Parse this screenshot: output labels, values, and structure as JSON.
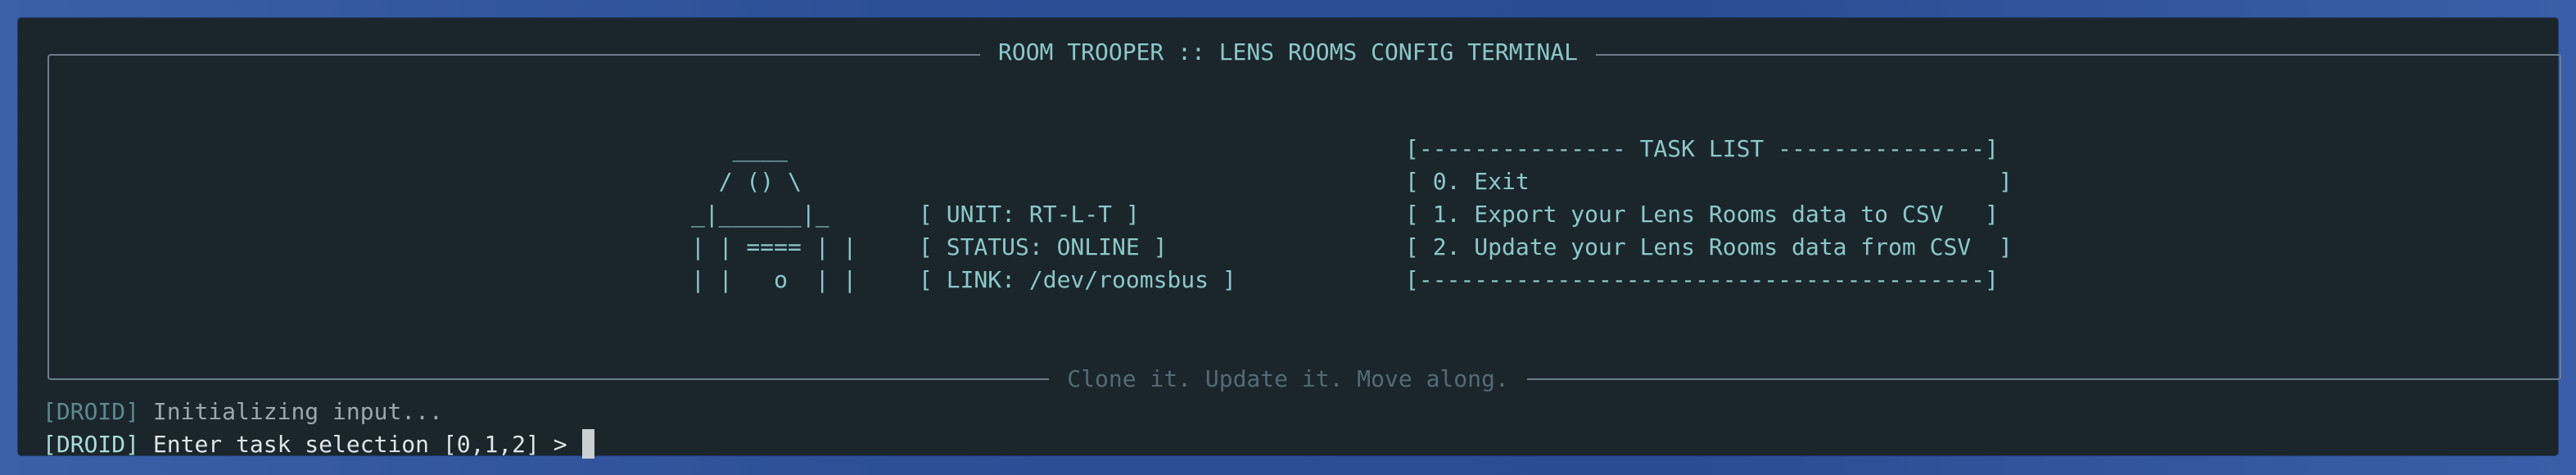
{
  "frame": {
    "title": "ROOM TROOPER :: LENS ROOMS CONFIG TERMINAL",
    "footer": "Clone it. Update it. Move along."
  },
  "droid_art": [
    "   ____",
    "  / () \\",
    "_|______|_",
    "| | ==== | |",
    "| |   o  | |"
  ],
  "unit_info": {
    "unit": "[ UNIT: RT-L-T ]",
    "status": "[ STATUS: ONLINE ]",
    "link": "[ LINK: /dev/roomsbus ]"
  },
  "task_list": {
    "header": "[--------------- TASK LIST ---------------]",
    "items": [
      "[ 0. Exit                                  ]",
      "[ 1. Export your Lens Rooms data to CSV   ]",
      "[ 2. Update your Lens Rooms data from CSV  ]"
    ],
    "footer": "[-----------------------------------------]"
  },
  "console": {
    "line1_tag": "[DROID]",
    "line1_text": "Initializing input...",
    "line2_tag": "[DROID]",
    "line2_text": "Enter task selection [0,1,2] >"
  },
  "colors": {
    "background_gradient_start": "#3b5fa8",
    "terminal_bg": "#1b262c",
    "frame_border": "#6b7d88",
    "accent_teal": "#8cc8c8",
    "footer_dim": "#546a74",
    "prompt_text": "#dfe6e8"
  }
}
